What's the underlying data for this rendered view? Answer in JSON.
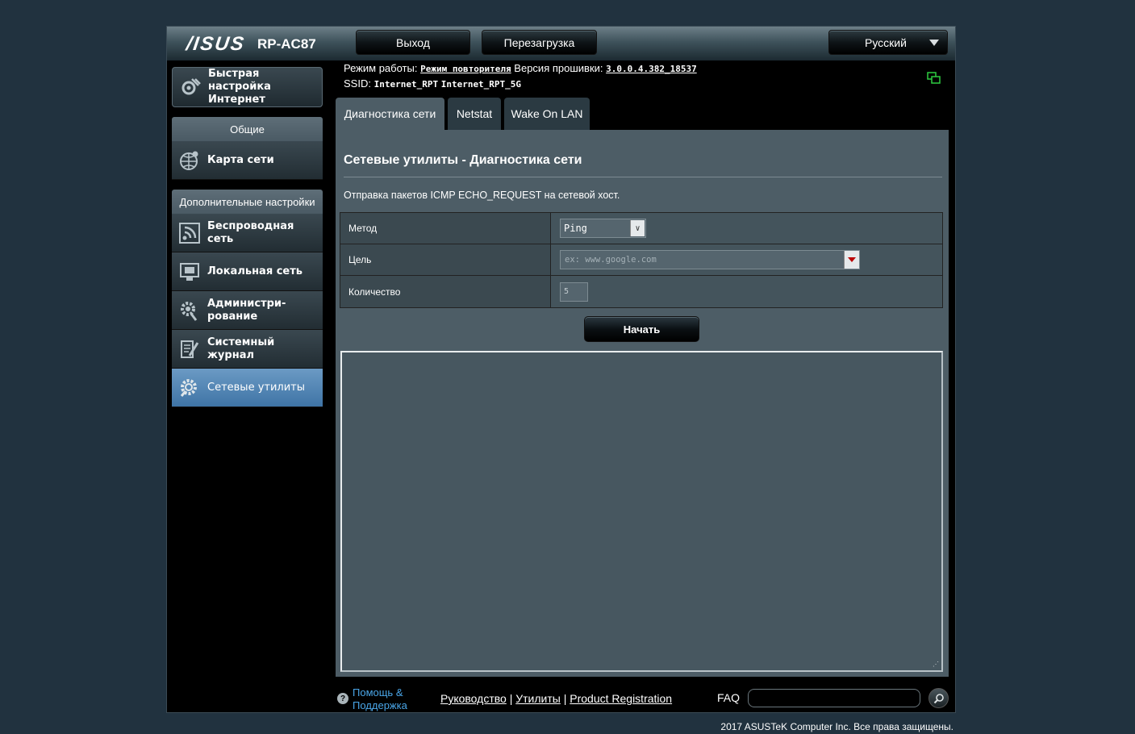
{
  "header": {
    "logo": "/ISUS",
    "model": "RP-AC87",
    "logout_label": "Выход",
    "reboot_label": "Перезагрузка",
    "language": "Русский"
  },
  "sidebar": {
    "quick_setup": "Быстрая настройка Интернет",
    "general_header": "Общие",
    "network_map": "Карта сети",
    "advanced_header": "Дополнительные настройки",
    "items": [
      {
        "label": "Беспроводная сеть",
        "icon": "wireless-icon"
      },
      {
        "label": "Локальная сеть",
        "icon": "lan-icon"
      },
      {
        "label": "Администри-рование",
        "icon": "admin-gear-icon"
      },
      {
        "label": "Системный журнал",
        "icon": "system-log-icon"
      },
      {
        "label": "Сетевые утилиты",
        "icon": "network-tools-icon"
      }
    ],
    "active_index": 4
  },
  "info": {
    "mode_label": "Режим работы:",
    "mode_value": "Режим повторителя",
    "firmware_label": "Версия прошивки:",
    "firmware_value": "3.0.0.4.382_18537",
    "ssid_label": "SSID:",
    "ssid_1": "Internet_RPT",
    "ssid_2": "Internet_RPT_5G"
  },
  "tabs": [
    {
      "label": "Диагностика сети",
      "active": true
    },
    {
      "label": "Netstat",
      "active": false
    },
    {
      "label": "Wake On LAN",
      "active": false
    }
  ],
  "panel": {
    "title": "Сетевые утилиты - Диагностика сети",
    "description": "Отправка пакетов ICMP ECHO_REQUEST на сетевой хост.",
    "method_label": "Метод",
    "method_value": "Ping",
    "target_label": "Цель",
    "target_placeholder": "ex: www.google.com",
    "count_label": "Количество",
    "count_value": "5",
    "start_label": "Начать",
    "output_text": ""
  },
  "footer": {
    "help_label": "Помощь & Поддержка",
    "manual": "Руководство",
    "utilities": "Утилиты",
    "registration": "Product Registration",
    "separator": "|",
    "faq": "FAQ",
    "copyright": "2017 ASUSTeK Computer Inc. Все права защищены."
  },
  "colors": {
    "background": "#21323f",
    "panel": "#4d5d66",
    "active_item": "#3f74a6",
    "help_link": "#4aa6e8",
    "status_icon": "#2ecc40"
  }
}
